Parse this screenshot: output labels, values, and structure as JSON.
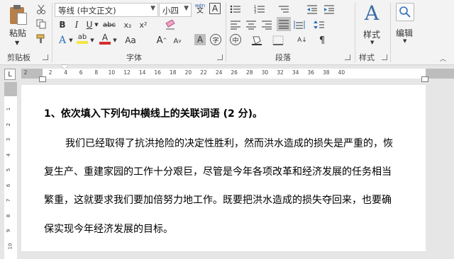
{
  "clipboard": {
    "paste_label": "粘贴",
    "group_label": "剪贴板"
  },
  "font": {
    "font_name": "等线 (中文正文)",
    "font_size": "小四",
    "group_label": "字体",
    "wen_label": "wén",
    "wen_char": "文",
    "frame_char": "A",
    "bold": "B",
    "italic": "I",
    "underline": "U",
    "strike": "abc",
    "sub": "x₂",
    "sup": "x²",
    "grow": "A",
    "shrink": "A",
    "aa": "Aa",
    "shade": "A",
    "circle_char": "字",
    "text_effect": "A",
    "font_color_A": "A",
    "highlight_pen": "ab"
  },
  "paragraph": {
    "group_label": "段落"
  },
  "styles": {
    "label": "样式",
    "group_label": "样式"
  },
  "editing": {
    "label": "编辑"
  },
  "ruler": {
    "tab_selector": "L",
    "ticks": [
      "2",
      "2",
      "4",
      "6",
      "8",
      "10",
      "12",
      "14",
      "16",
      "18",
      "20",
      "22",
      "24",
      "26",
      "28",
      "30",
      "32",
      "34",
      "36",
      "38",
      "40"
    ],
    "vticks": [
      "1",
      "2",
      "3",
      "4",
      "5",
      "6",
      "7",
      "8",
      "9",
      "10"
    ]
  },
  "document": {
    "heading": "1、依次填入下列句中横线上的关联词语 (2 分)。",
    "lines": [
      "我们已经取得了抗洪抢险的决定性胜利，然而洪水造成的损失是严重的，恢",
      "复生产、重建家园的工作十分艰巨，尽管是今年各项改革和经济发展的任务相当",
      "繁重，这就要求我们要加倍努力地工作。既要把洪水造成的损失夺回来，也要确",
      "保实现今年经济发展的目标。"
    ]
  },
  "colors": {
    "highlight": "#f4e542",
    "font_color": "#d32f2f",
    "accent_blue": "#3a6ea5"
  }
}
